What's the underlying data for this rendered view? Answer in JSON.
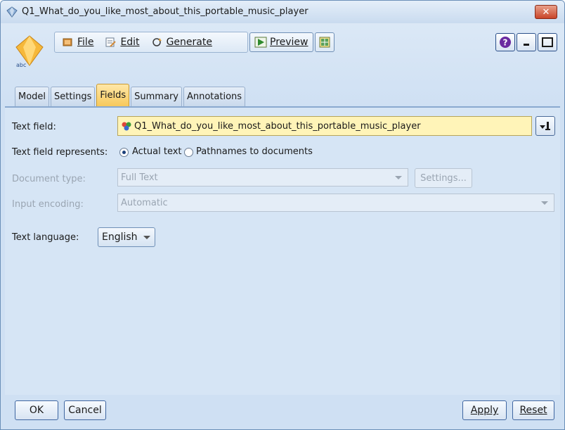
{
  "window": {
    "title": "Q1_What_do_you_like_most_about_this_portable_music_player"
  },
  "menu": {
    "file": "File",
    "edit": "Edit",
    "generate": "Generate",
    "preview": "Preview"
  },
  "tabs": [
    {
      "label": "Model",
      "active": false
    },
    {
      "label": "Settings",
      "active": false
    },
    {
      "label": "Fields",
      "active": true
    },
    {
      "label": "Summary",
      "active": false
    },
    {
      "label": "Annotations",
      "active": false
    }
  ],
  "form": {
    "text_field_label": "Text field:",
    "text_field_value": "Q1_What_do_you_like_most_about_this_portable_music_player",
    "represents_label": "Text field represents:",
    "represents_options": [
      "Actual text",
      "Pathnames to documents"
    ],
    "represents_selected": "Actual text",
    "document_type_label": "Document type:",
    "document_type_value": "Full Text",
    "settings_button": "Settings...",
    "input_encoding_label": "Input encoding:",
    "input_encoding_value": "Automatic",
    "text_language_label": "Text language:",
    "text_language_value": "English"
  },
  "footer": {
    "ok": "OK",
    "cancel": "Cancel",
    "apply": "Apply",
    "reset": "Reset"
  },
  "colors": {
    "active_tab": "#f7c95b",
    "text_field_bg": "#fff4b8",
    "close_button": "#c9452a"
  }
}
